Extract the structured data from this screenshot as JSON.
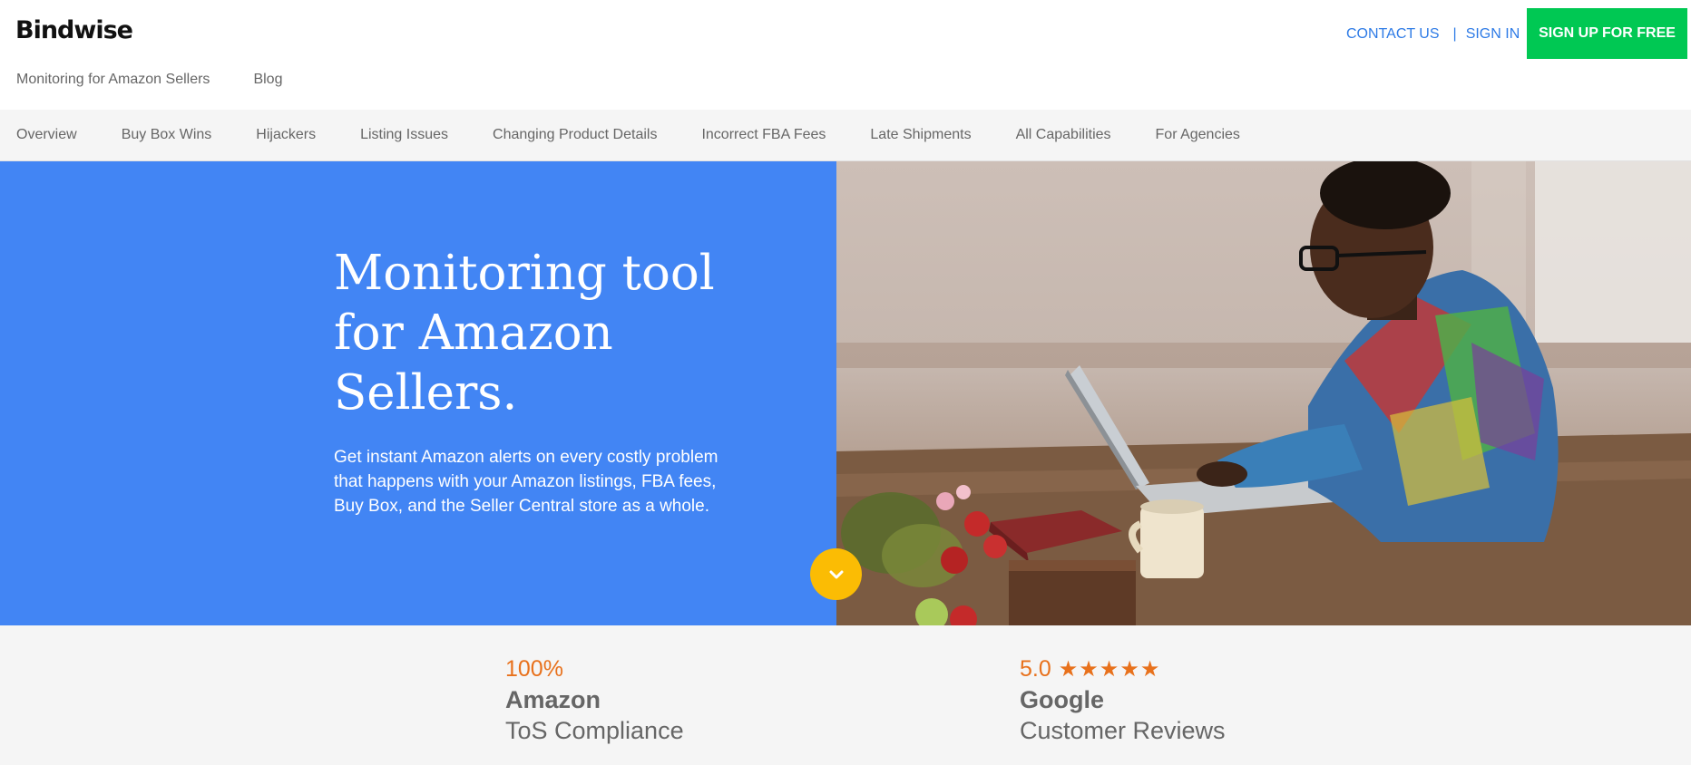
{
  "header": {
    "logo": "Bindwise",
    "subnav": [
      "Monitoring for Amazon Sellers",
      "Blog"
    ],
    "contact": "CONTACT US",
    "separator": "|",
    "signin": "SIGN IN",
    "signup": "SIGN UP FOR FREE"
  },
  "catnav": {
    "items": [
      "Overview",
      "Buy Box Wins",
      "Hijackers",
      "Listing Issues",
      "Changing Product Details",
      "Incorrect FBA Fees",
      "Late Shipments",
      "All Capabilities",
      "For Agencies"
    ]
  },
  "hero": {
    "title_lines": [
      "Monitoring tool",
      "for Amazon",
      "Sellers."
    ],
    "description": "Get instant Amazon alerts on every costly problem that happens with your Amazon listings, FBA fees, Buy Box, and the Seller Central store as a whole.",
    "scroll_icon": "chevron-down-icon",
    "background_color": "#4285f4"
  },
  "stats": [
    {
      "kpi": "100%",
      "bold": "Amazon",
      "light": "ToS Compliance"
    },
    {
      "kpi": "5.0",
      "stars": "★★★★★",
      "bold": "Google",
      "light": "Customer Reviews"
    }
  ],
  "colors": {
    "accent_blue": "#2e7be6",
    "signup_green": "#00c853",
    "stat_orange": "#e8711c",
    "scroll_yellow": "#fbbc04"
  }
}
